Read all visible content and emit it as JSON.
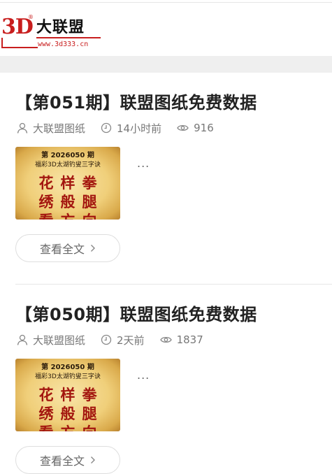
{
  "header": {
    "logo_mark": "3D",
    "logo_reg": "®",
    "logo_name": "大联盟",
    "logo_url": "www.3d333.cn"
  },
  "posts": [
    {
      "title": "【第051期】联盟图纸免费数据",
      "author": "大联盟图纸",
      "time": "14小时前",
      "views": "916",
      "thumb": {
        "issue": "第 2026050 期",
        "subtitle": "福彩3D太湖钓叟三字诀",
        "row1": "花样拳",
        "row2": "绣般腿",
        "row3": "看方向"
      },
      "excerpt": "...",
      "read_more": "查看全文"
    },
    {
      "title": "【第050期】联盟图纸免费数据",
      "author": "大联盟图纸",
      "time": "2天前",
      "views": "1837",
      "thumb": {
        "issue": "第 2026050 期",
        "subtitle": "福彩3D太湖钓叟三字诀",
        "row1": "花样拳",
        "row2": "绣般腿",
        "row3": "看方向"
      },
      "excerpt": "...",
      "read_more": "查看全文"
    }
  ],
  "icons": {
    "author": "user-icon",
    "time": "clock-icon",
    "views": "eye-icon",
    "read_more": "chevron-right-icon"
  },
  "colors": {
    "brand_red": "#c81e1e",
    "title_text": "#222222",
    "meta_text": "#777777",
    "band_gray": "#efefef"
  }
}
